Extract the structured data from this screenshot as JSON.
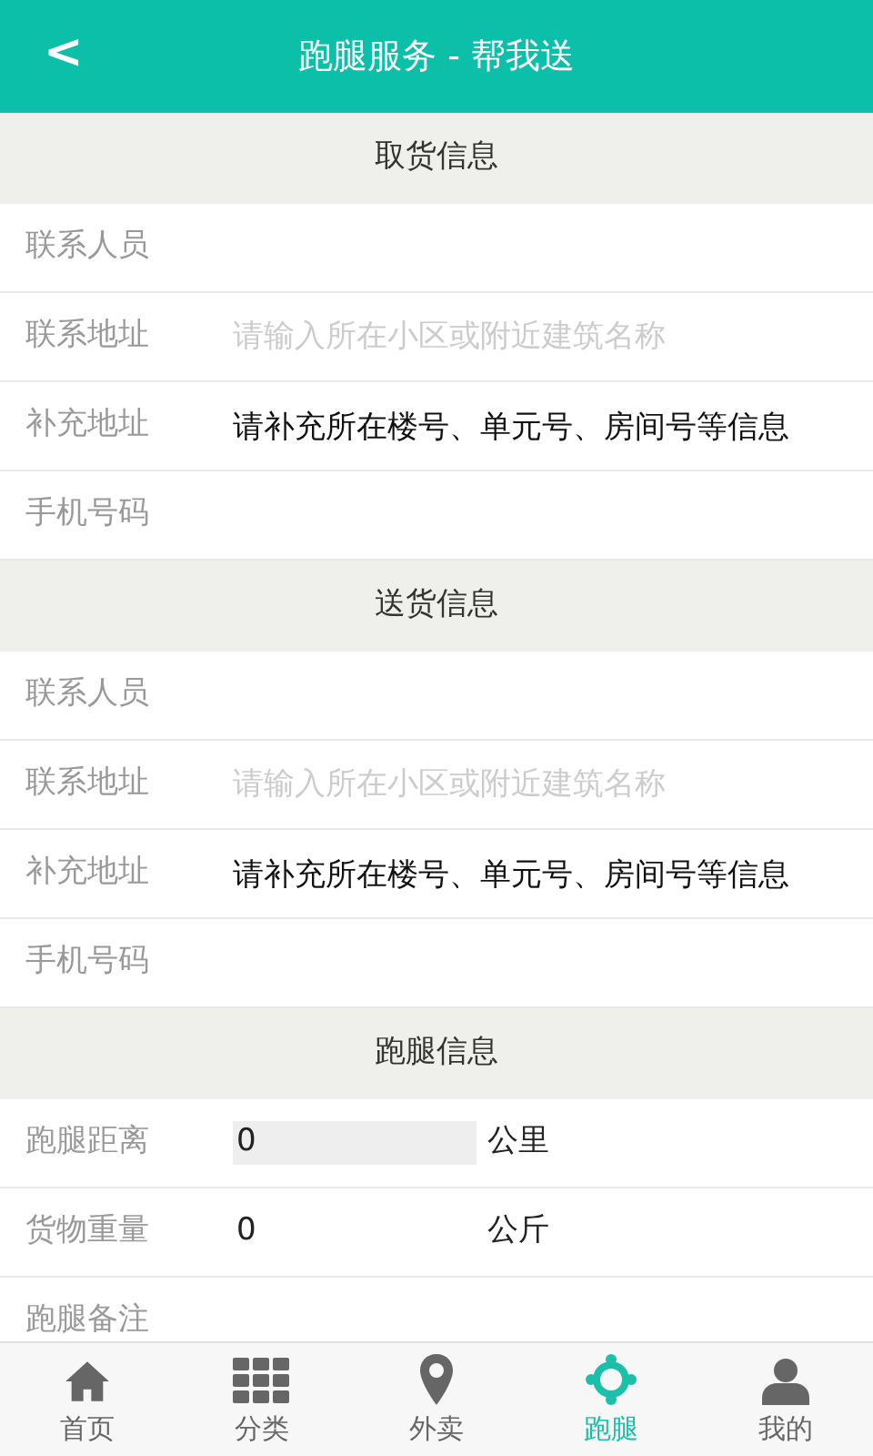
{
  "header": {
    "back": "<",
    "title": "跑腿服务 - 帮我送"
  },
  "sections": [
    {
      "title": "取货信息",
      "rows": [
        {
          "kind": "text",
          "label": "联系人员"
        },
        {
          "kind": "text",
          "label": "联系地址",
          "placeholder": "请输入所在小区或附近建筑名称"
        },
        {
          "kind": "text",
          "label": "补充地址",
          "value": "请补充所在楼号、单元号、房间号等信息"
        },
        {
          "kind": "text",
          "label": "手机号码"
        }
      ]
    },
    {
      "title": "送货信息",
      "rows": [
        {
          "kind": "text",
          "label": "联系人员"
        },
        {
          "kind": "text",
          "label": "联系地址",
          "placeholder": "请输入所在小区或附近建筑名称"
        },
        {
          "kind": "text",
          "label": "补充地址",
          "value": "请补充所在楼号、单元号、房间号等信息"
        },
        {
          "kind": "text",
          "label": "手机号码"
        }
      ]
    },
    {
      "title": "跑腿信息",
      "rows": [
        {
          "kind": "unit",
          "label": "跑腿距离",
          "value": "0",
          "unit": "公里",
          "shaded": true
        },
        {
          "kind": "unit",
          "label": "货物重量",
          "value": "0",
          "unit": "公斤",
          "shaded": false
        },
        {
          "kind": "text",
          "label": "跑腿备注"
        }
      ]
    }
  ],
  "nav": [
    {
      "kind": "home",
      "label": "首页",
      "selected": false
    },
    {
      "kind": "grid",
      "label": "分类",
      "selected": false
    },
    {
      "kind": "pin",
      "label": "外卖",
      "selected": false
    },
    {
      "kind": "target",
      "label": "跑腿",
      "selected": true
    },
    {
      "kind": "person",
      "label": "我的",
      "selected": false
    }
  ]
}
